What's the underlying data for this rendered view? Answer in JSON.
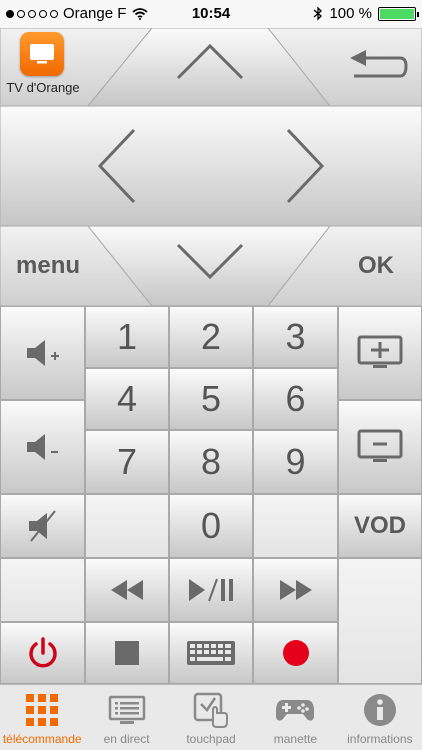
{
  "status_bar": {
    "carrier": "Orange F",
    "time": "10:54",
    "battery": "100 %"
  },
  "app": {
    "label": "TV d'Orange"
  },
  "dpad": {
    "menu_label": "menu",
    "ok_label": "OK"
  },
  "keypad": {
    "digits": [
      "1",
      "2",
      "3",
      "4",
      "5",
      "6",
      "7",
      "8",
      "9",
      "0"
    ],
    "vod_label": "VOD"
  },
  "tabs": [
    {
      "label": "télécommande",
      "icon": "grid-icon",
      "active": true
    },
    {
      "label": "en direct",
      "icon": "tv-list-icon",
      "active": false
    },
    {
      "label": "touchpad",
      "icon": "touchpad-icon",
      "active": false
    },
    {
      "label": "manette",
      "icon": "gamepad-icon",
      "active": false
    },
    {
      "label": "informations",
      "icon": "info-icon",
      "active": false
    }
  ],
  "colors": {
    "accent": "#f06a00",
    "record": "#e4001b",
    "power": "#d0021b"
  }
}
